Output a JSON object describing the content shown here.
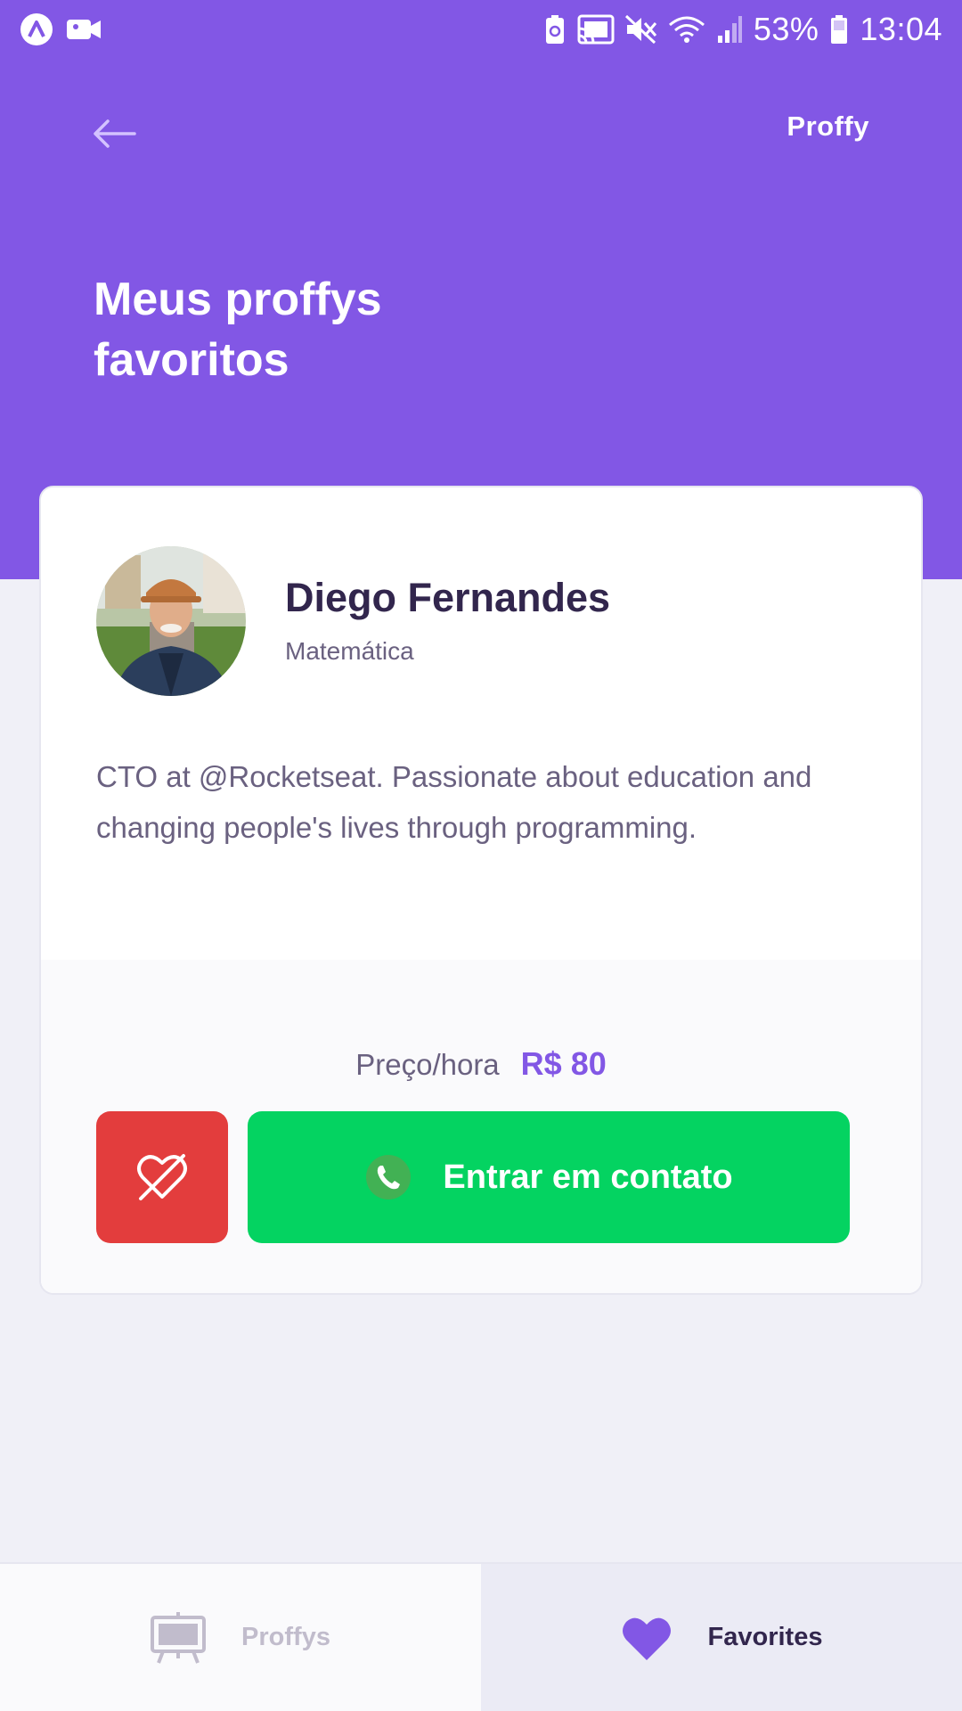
{
  "status_bar": {
    "battery_percent": "53%",
    "time": "13:04",
    "icons": [
      "app-logo-icon",
      "video-camera-icon",
      "battery-saver-icon",
      "cast-icon",
      "mute-icon",
      "wifi-icon",
      "signal-icon",
      "battery-icon"
    ]
  },
  "header": {
    "back_icon": "arrow-left-icon",
    "logo": "Proffy",
    "title_line1": "Meus proffys",
    "title_line2": "favoritos"
  },
  "teacher": {
    "name": "Diego Fernandes",
    "subject": "Matemática",
    "bio": "CTO at @Rocketseat. Passionate about education and changing people's lives through programming.",
    "price_label": "Preço/hora",
    "price_value": "R$ 80",
    "unfavorite_icon": "heart-outline-slash-icon",
    "contact_label": "Entrar em contato",
    "contact_icon": "whatsapp-icon"
  },
  "tabs": [
    {
      "label": "Proffys",
      "icon": "easel-icon",
      "active": false
    },
    {
      "label": "Favorites",
      "icon": "heart-icon",
      "active": true
    }
  ],
  "colors": {
    "primary": "#8257e5",
    "danger": "#e33d3d",
    "success": "#04d361",
    "background": "#f0f0f7",
    "title_text": "#32264d",
    "body_text": "#6a6180"
  }
}
